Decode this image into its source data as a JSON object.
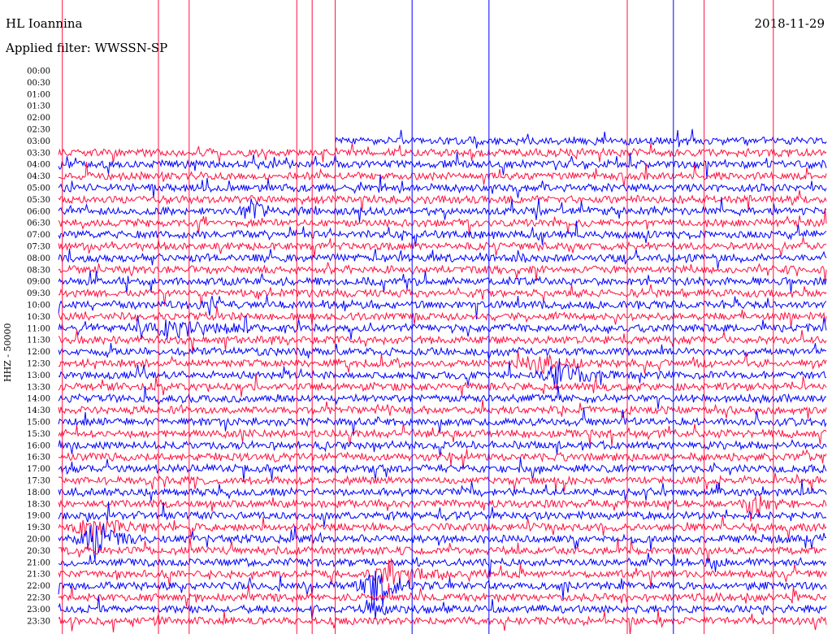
{
  "header": {
    "station": "HL Ioannina",
    "filter": "Applied filter: WWSSN-SP",
    "date": "2018-11-29"
  },
  "chart_data": {
    "type": "line",
    "ylabel": "HHZ - 50000",
    "tick_labels": [
      "00:00",
      "00:30",
      "01:00",
      "01:30",
      "02:00",
      "02:30",
      "03:00",
      "03:30",
      "04:00",
      "04:30",
      "05:00",
      "05:30",
      "06:00",
      "06:30",
      "07:00",
      "07:30",
      "08:00",
      "08:30",
      "09:00",
      "09:30",
      "10:00",
      "10:30",
      "11:00",
      "11:30",
      "12:00",
      "12:30",
      "13:00",
      "13:30",
      "14:00",
      "14:30",
      "15:00",
      "15:30",
      "16:00",
      "16:30",
      "17:00",
      "17:30",
      "18:00",
      "18:30",
      "19:00",
      "19:30",
      "20:00",
      "20:30",
      "21:00",
      "21:30",
      "22:00",
      "22:30",
      "23:00",
      "23:30"
    ],
    "trace_start": "03:00",
    "trace_start_fraction": 0.36,
    "series_colors": [
      "#0000ff",
      "#ff1040"
    ],
    "seed": 20181129,
    "events": [
      {
        "row": "06:00",
        "pos": 0.25,
        "amp": 14,
        "width": 0.02
      },
      {
        "row": "11:00",
        "pos": 0.14,
        "amp": 10,
        "width": 0.06
      },
      {
        "row": "12:30",
        "pos": 0.62,
        "amp": 12,
        "width": 0.03
      },
      {
        "row": "13:00",
        "pos": 0.65,
        "amp": 18,
        "width": 0.03
      },
      {
        "row": "18:30",
        "pos": 0.9,
        "amp": 16,
        "width": 0.02
      },
      {
        "row": "19:30",
        "pos": 0.04,
        "amp": 18,
        "width": 0.03
      },
      {
        "row": "20:00",
        "pos": 0.04,
        "amp": 20,
        "width": 0.03
      },
      {
        "row": "21:30",
        "pos": 0.43,
        "amp": 18,
        "width": 0.03
      },
      {
        "row": "22:00",
        "pos": 0.41,
        "amp": 20,
        "width": 0.03
      },
      {
        "row": "23:00",
        "pos": 0.41,
        "amp": 12,
        "width": 0.02
      }
    ],
    "spikes": [
      {
        "pos": 0.005,
        "color": "#ff1040"
      },
      {
        "pos": 0.13,
        "color": "#ff1040"
      },
      {
        "pos": 0.17,
        "color": "#ff1040"
      },
      {
        "pos": 0.31,
        "color": "#ff1040"
      },
      {
        "pos": 0.33,
        "color": "#ff1040"
      },
      {
        "pos": 0.36,
        "color": "#ff1040"
      },
      {
        "pos": 0.46,
        "color": "#0000ff"
      },
      {
        "pos": 0.56,
        "color": "#0000ff"
      },
      {
        "pos": 0.74,
        "color": "#ff1040"
      },
      {
        "pos": 0.8,
        "color": "#0000ff"
      },
      {
        "pos": 0.84,
        "color": "#ff1040"
      },
      {
        "pos": 0.93,
        "color": "#ff1040"
      }
    ],
    "grid": false
  }
}
